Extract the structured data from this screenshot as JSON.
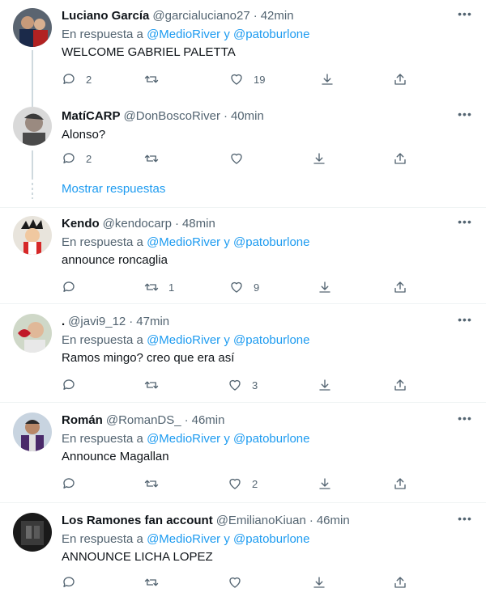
{
  "reply_prefix": "En respuesta a",
  "reply_conj": "y",
  "more_glyph": "•••",
  "show_replies": "Mostrar respuestas",
  "icons": [
    "reply-icon",
    "retweet-icon",
    "like-icon",
    "download-icon",
    "share-icon"
  ],
  "colors": {
    "link": "#1d9bf0",
    "secondary": "#536471",
    "text": "#0f1419",
    "divider": "#eff3f4"
  },
  "tweets": [
    {
      "name": "Luciano García",
      "handle": "@garcialuciano27",
      "time": "42min",
      "reply_to": [
        "@MedioRiver",
        "@patoburlone"
      ],
      "text": "WELCOME GABRIEL PALETTA",
      "replies": "2",
      "retweets": "",
      "likes": "19"
    },
    {
      "name": "MatíCARP",
      "handle": "@DonBoscoRiver",
      "time": "40min",
      "reply_to": [],
      "text": "Alonso?",
      "replies": "2",
      "retweets": "",
      "likes": ""
    },
    {
      "name": "Kendo",
      "handle": "@kendocarp",
      "time": "48min",
      "reply_to": [
        "@MedioRiver",
        "@patoburlone"
      ],
      "text": "announce roncaglia",
      "replies": "",
      "retweets": "1",
      "likes": "9"
    },
    {
      "name": ".",
      "handle": "@javi9_12",
      "time": "47min",
      "reply_to": [
        "@MedioRiver",
        "@patoburlone"
      ],
      "text": "Ramos mingo? creo que era así",
      "replies": "",
      "retweets": "",
      "likes": "3"
    },
    {
      "name": "Román",
      "handle": "@RomanDS_",
      "time": "46min",
      "reply_to": [
        "@MedioRiver",
        "@patoburlone"
      ],
      "text": "Announce Magallan",
      "replies": "",
      "retweets": "",
      "likes": "2"
    },
    {
      "name": "Los Ramones fan account",
      "handle": "@EmilianoKiuan",
      "time": "46min",
      "reply_to": [
        "@MedioRiver",
        "@patoburlone"
      ],
      "text": "ANNOUNCE LICHA LOPEZ",
      "replies": "",
      "retweets": "",
      "likes": ""
    }
  ]
}
